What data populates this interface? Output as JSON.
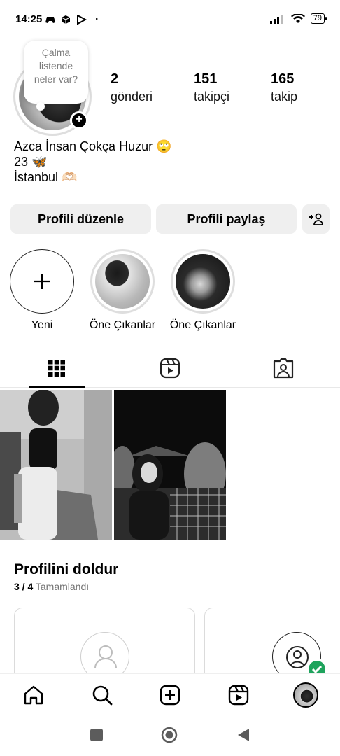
{
  "status_bar": {
    "time": "14:25",
    "dot": "·",
    "battery": "79",
    "left_icons": [
      "gamepad-icon",
      "box-icon",
      "play-store-icon"
    ],
    "right_icons": [
      "signal-icon",
      "wifi-icon",
      "battery-icon"
    ]
  },
  "profile": {
    "note_text": "Çalma listende neler var?",
    "stats": [
      {
        "value": "2",
        "label": "gönderi"
      },
      {
        "value": "151",
        "label": "takipçi"
      },
      {
        "value": "165",
        "label": "takip"
      }
    ],
    "bio": {
      "line1": "Azca İnsan Çokça Huzur 🙄",
      "line2": "23 🦋",
      "line3": "İstanbul 🫶🏻"
    }
  },
  "actions": {
    "edit_profile": "Profili düzenle",
    "share_profile": "Profili paylaş"
  },
  "highlights": [
    {
      "label": "Yeni"
    },
    {
      "label": "Öne Çıkanlar"
    },
    {
      "label": "Öne Çıkanlar"
    }
  ],
  "tabs": [
    "grid-icon",
    "reels-icon",
    "tagged-icon"
  ],
  "profile_completion": {
    "title": "Profilini doldur",
    "progress_count": "3 / 4",
    "progress_label": "Tamamlandı"
  },
  "bottom_nav": [
    "home-icon",
    "search-icon",
    "create-icon",
    "reels-icon",
    "profile-avatar"
  ],
  "colors": {
    "button_bg": "#efefef",
    "ring": "#dedede",
    "check_green": "#1ea35c"
  }
}
